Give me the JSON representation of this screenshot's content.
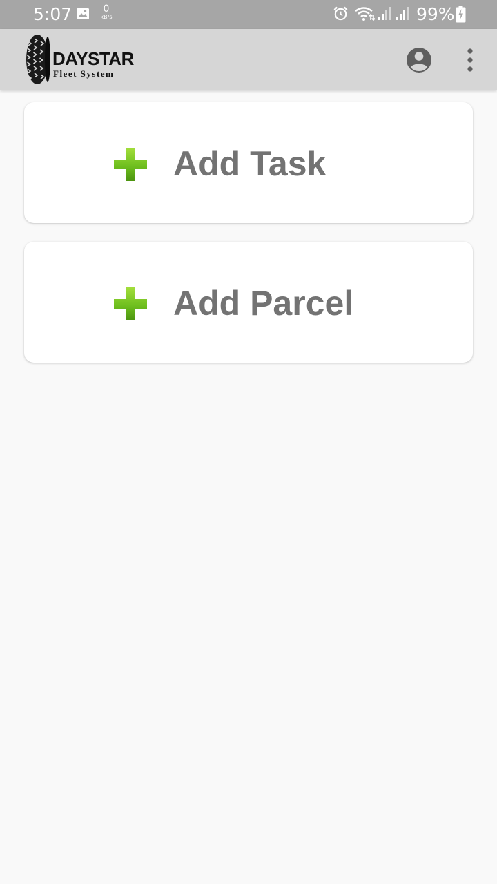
{
  "status_bar": {
    "time": "5:07",
    "net_speed_value": "0",
    "net_speed_unit": "kB/s",
    "battery_percent": "99%",
    "icons": [
      "gallery-icon",
      "alarm-icon",
      "wifi-icon",
      "signal-icon",
      "signal-icon",
      "battery-charging-icon"
    ]
  },
  "app_bar": {
    "brand": "DAYSTAR",
    "subtitle": "Fleet System",
    "icons": [
      "account-circle-icon",
      "more-vert-icon"
    ]
  },
  "actions": [
    {
      "label": "Add Task",
      "icon": "plus-icon"
    },
    {
      "label": "Add Parcel",
      "icon": "plus-icon"
    }
  ],
  "colors": {
    "status_bar_bg": "#a6a6a6",
    "app_bar_bg": "#d6d6d6",
    "page_bg": "#f9f9f9",
    "card_bg": "#ffffff",
    "label_text": "#737373",
    "plus_green": "#6fbf1f",
    "icon_dark": "#5f5f5f"
  }
}
